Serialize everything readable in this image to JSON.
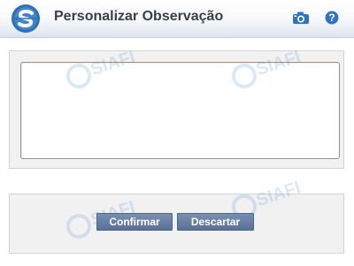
{
  "header": {
    "title": "Personalizar Observação",
    "logo_icon": "siafi-logo-icon",
    "camera_icon": "camera-icon",
    "help_icon": "help-icon",
    "help_glyph": "?"
  },
  "form": {
    "observation_value": ""
  },
  "buttons": {
    "confirm_label": "Confirmar",
    "discard_label": "Descartar"
  },
  "watermark": {
    "text": "SIAFI"
  },
  "colors": {
    "title_text": "#3a3f46",
    "button_bg": "#637898",
    "icon_blue": "#2f74c0",
    "panel_bg": "#f1f1f1"
  }
}
